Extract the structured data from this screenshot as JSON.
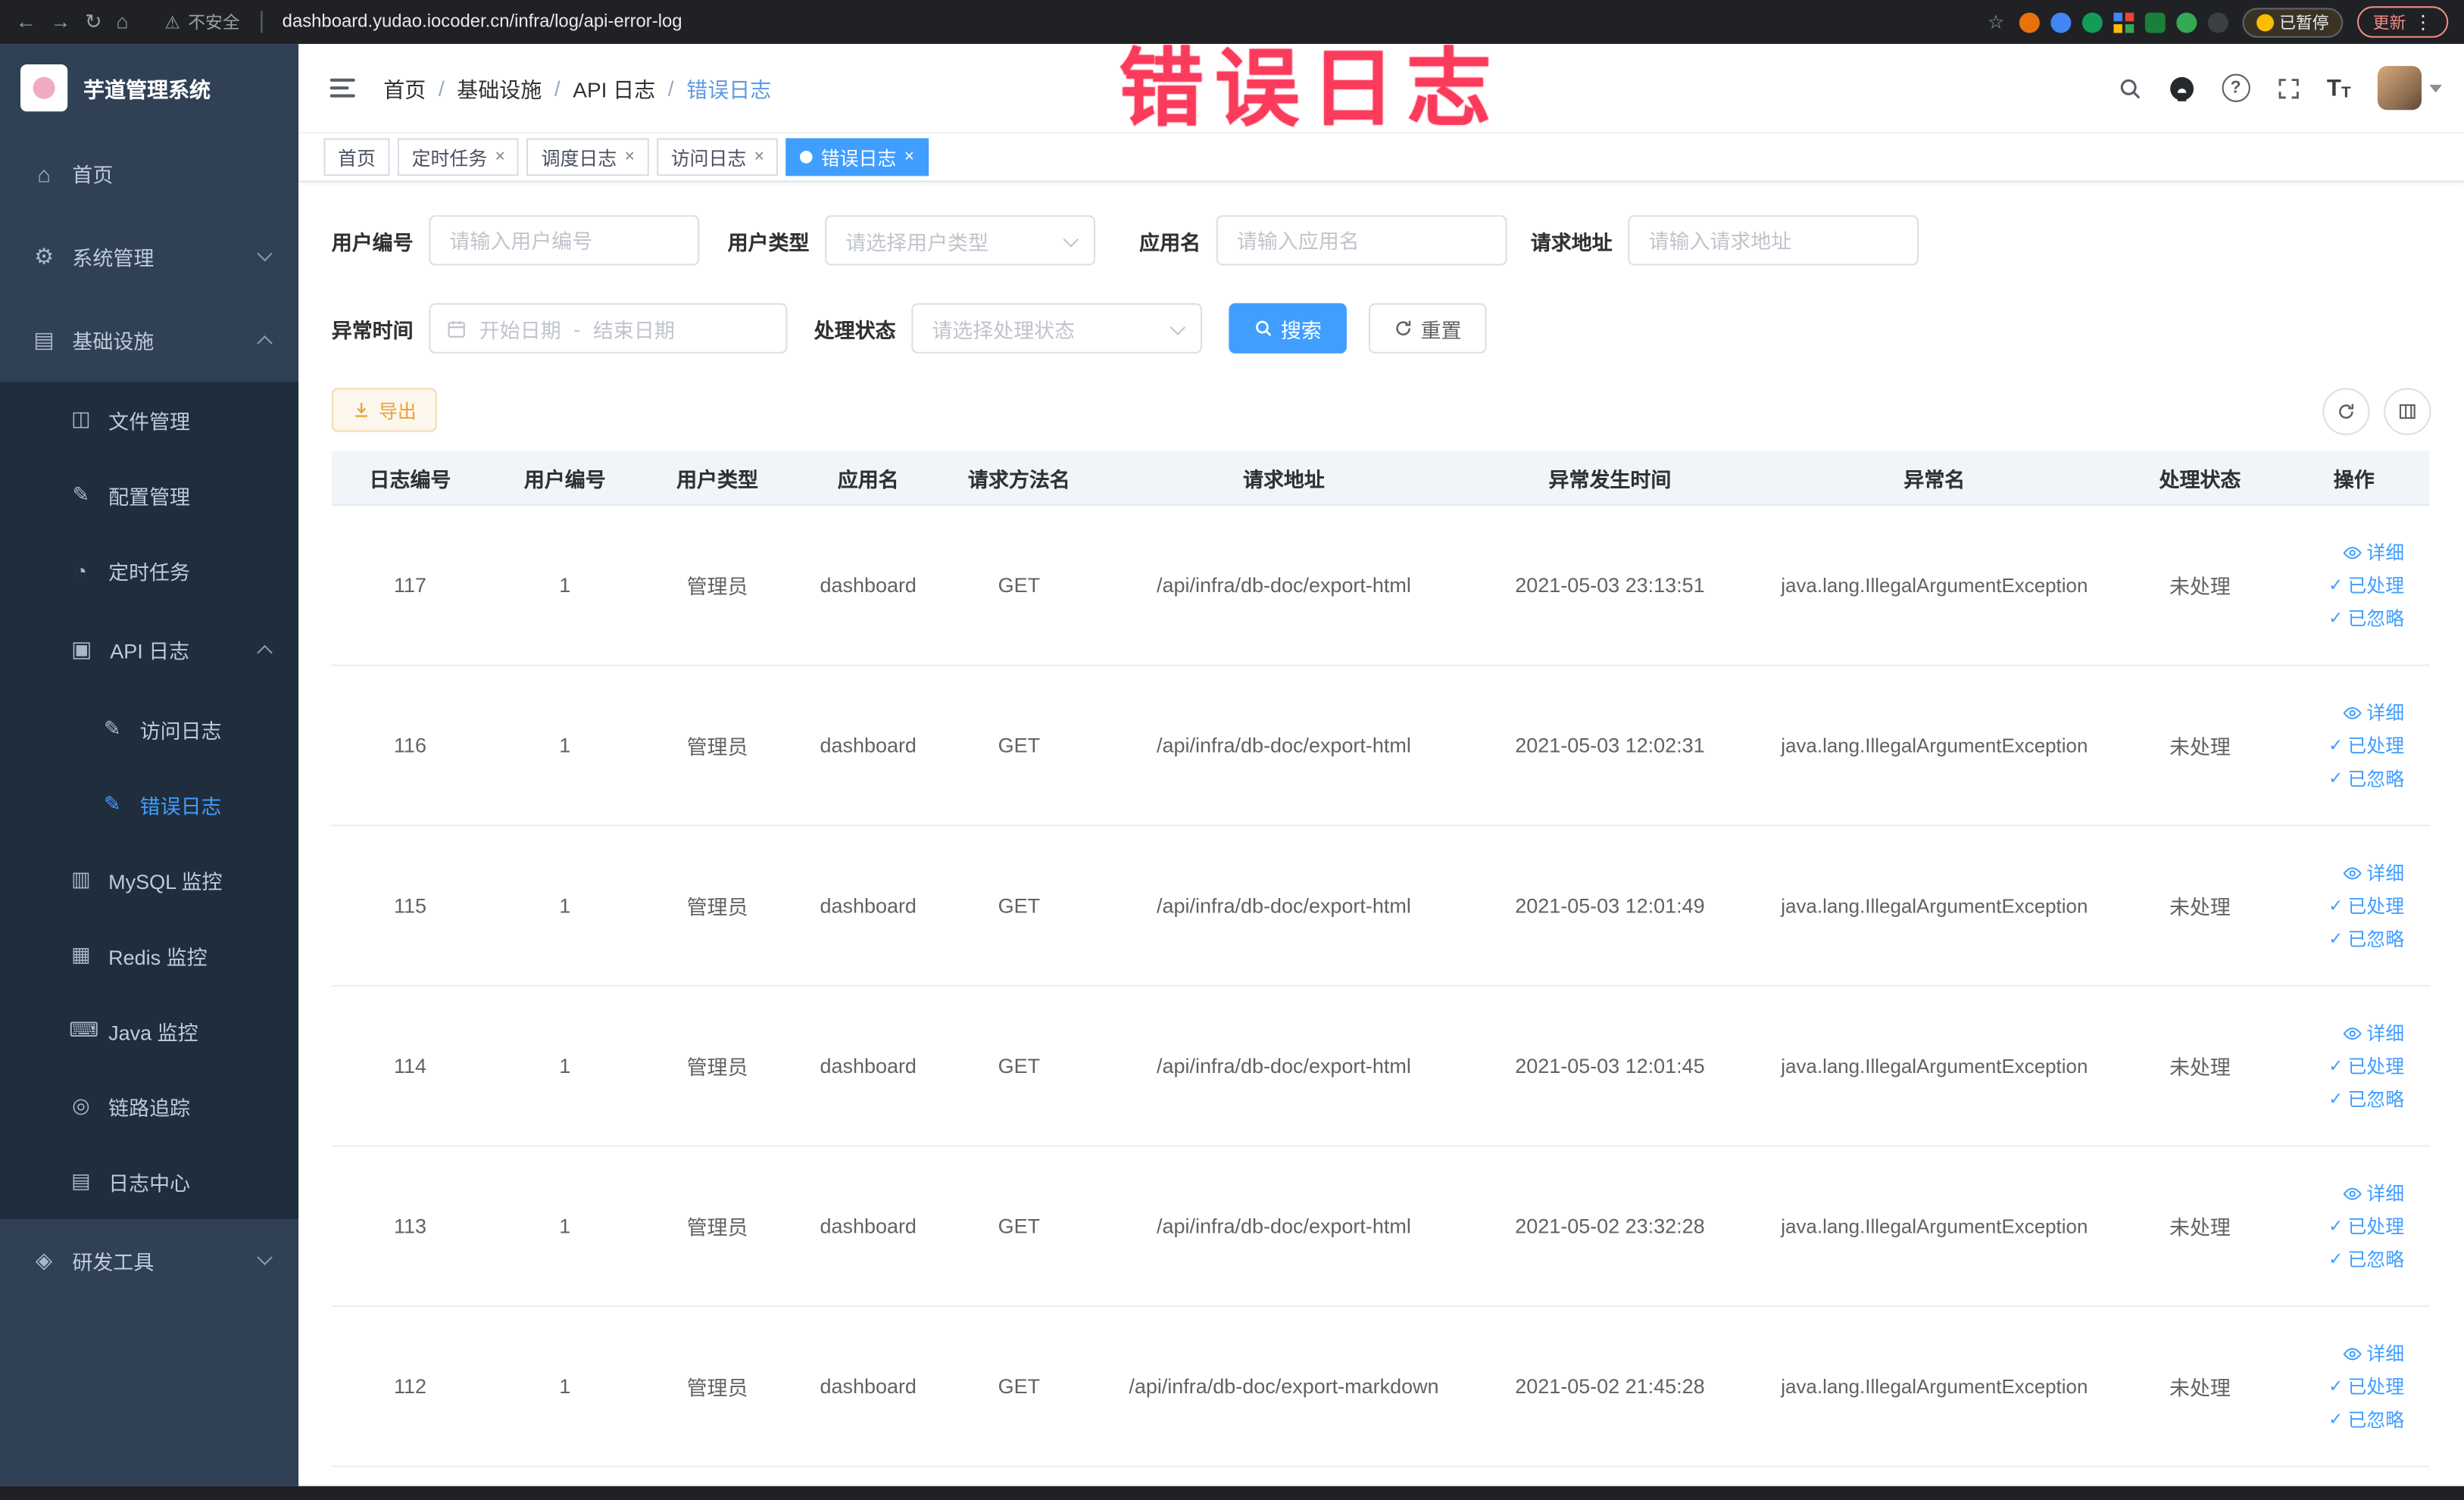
{
  "colors": {
    "accent": "#409eff",
    "warning": "#e6a23c",
    "annotation": "#fb3b5c",
    "sidebar_bg": "#304156",
    "submenu_bg": "#1f2d3d"
  },
  "annotation": {
    "text": "错误日志"
  },
  "browser": {
    "security_label": "不安全",
    "url": "dashboard.yudao.iocoder.cn/infra/log/api-error-log",
    "paused_badge": "已暂停",
    "update_label": "更新"
  },
  "sidebar": {
    "title": "芋道管理系统",
    "items": [
      {
        "label": "首页"
      },
      {
        "label": "系统管理"
      },
      {
        "label": "基础设施"
      },
      {
        "label": "文件管理"
      },
      {
        "label": "配置管理"
      },
      {
        "label": "定时任务"
      },
      {
        "label": "API 日志"
      },
      {
        "label": "访问日志"
      },
      {
        "label": "错误日志"
      },
      {
        "label": "MySQL 监控"
      },
      {
        "label": "Redis 监控"
      },
      {
        "label": "Java 监控"
      },
      {
        "label": "链路追踪"
      },
      {
        "label": "日志中心"
      },
      {
        "label": "研发工具"
      }
    ]
  },
  "breadcrumb": {
    "separator": "/",
    "items": [
      "首页",
      "基础设施",
      "API 日志",
      "错误日志"
    ]
  },
  "tags": [
    {
      "label": "首页"
    },
    {
      "label": "定时任务"
    },
    {
      "label": "调度日志"
    },
    {
      "label": "访问日志"
    },
    {
      "label": "错误日志"
    }
  ],
  "filters": {
    "user_id": {
      "label": "用户编号",
      "placeholder": "请输入用户编号"
    },
    "user_type": {
      "label": "用户类型",
      "placeholder": "请选择用户类型"
    },
    "app_name": {
      "label": "应用名",
      "placeholder": "请输入应用名"
    },
    "request_url": {
      "label": "请求地址",
      "placeholder": "请输入请求地址"
    },
    "exception_time": {
      "label": "异常时间",
      "start_placeholder": "开始日期",
      "separator": "-",
      "end_placeholder": "结束日期"
    },
    "process_status": {
      "label": "处理状态",
      "placeholder": "请选择处理状态"
    },
    "search_label": "搜索",
    "reset_label": "重置"
  },
  "toolbar": {
    "export_label": "导出"
  },
  "table": {
    "columns": [
      "日志编号",
      "用户编号",
      "用户类型",
      "应用名",
      "请求方法名",
      "请求地址",
      "异常发生时间",
      "异常名",
      "处理状态",
      "操作"
    ],
    "actions": {
      "detail": "详细",
      "processed": "已处理",
      "ignore": "已忽略"
    },
    "rows": [
      {
        "id": "117",
        "user_id": "1",
        "user_type": "管理员",
        "app": "dashboard",
        "method": "GET",
        "url": "/api/infra/db-doc/export-html",
        "time": "2021-05-03 23:13:51",
        "exception": "java.lang.IllegalArgumentException",
        "status": "未处理"
      },
      {
        "id": "116",
        "user_id": "1",
        "user_type": "管理员",
        "app": "dashboard",
        "method": "GET",
        "url": "/api/infra/db-doc/export-html",
        "time": "2021-05-03 12:02:31",
        "exception": "java.lang.IllegalArgumentException",
        "status": "未处理"
      },
      {
        "id": "115",
        "user_id": "1",
        "user_type": "管理员",
        "app": "dashboard",
        "method": "GET",
        "url": "/api/infra/db-doc/export-html",
        "time": "2021-05-03 12:01:49",
        "exception": "java.lang.IllegalArgumentException",
        "status": "未处理"
      },
      {
        "id": "114",
        "user_id": "1",
        "user_type": "管理员",
        "app": "dashboard",
        "method": "GET",
        "url": "/api/infra/db-doc/export-html",
        "time": "2021-05-03 12:01:45",
        "exception": "java.lang.IllegalArgumentException",
        "status": "未处理"
      },
      {
        "id": "113",
        "user_id": "1",
        "user_type": "管理员",
        "app": "dashboard",
        "method": "GET",
        "url": "/api/infra/db-doc/export-html",
        "time": "2021-05-02 23:32:28",
        "exception": "java.lang.IllegalArgumentException",
        "status": "未处理"
      },
      {
        "id": "112",
        "user_id": "1",
        "user_type": "管理员",
        "app": "dashboard",
        "method": "GET",
        "url": "/api/infra/db-doc/export-markdown",
        "time": "2021-05-02 21:45:28",
        "exception": "java.lang.IllegalArgumentException",
        "status": "未处理"
      }
    ]
  }
}
